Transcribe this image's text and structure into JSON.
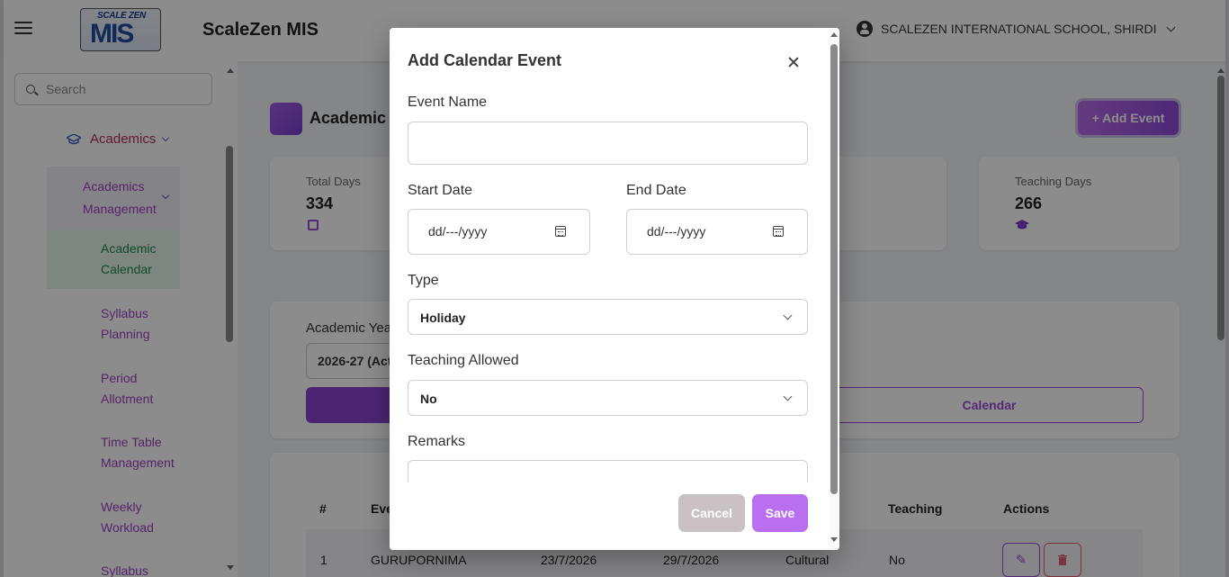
{
  "header": {
    "logo_top": "SCALE ZEN",
    "logo_main": "MIS",
    "app_title": "ScaleZen MIS",
    "school_name": "SCALEZEN INTERNATIONAL SCHOOL, SHIRDI"
  },
  "sidebar": {
    "search_placeholder": "Search",
    "section": "Academics",
    "group": [
      "Academics",
      "Management"
    ],
    "items": [
      {
        "line1": "Academic",
        "line2": "Calendar",
        "active": true
      },
      {
        "line1": "Syllabus",
        "line2": "Planning"
      },
      {
        "line1": "Period",
        "line2": "Allotment"
      },
      {
        "line1": "Time Table",
        "line2": "Management"
      },
      {
        "line1": "Weekly",
        "line2": "Workload"
      },
      {
        "line1": "Syllabus",
        "line2": ""
      }
    ]
  },
  "main": {
    "page_title": "Academic C",
    "add_event_label": "+ Add Event",
    "stats": {
      "total_days_label": "Total Days",
      "total_days_value": "334",
      "teaching_days_label": "Teaching Days",
      "teaching_days_value": "266"
    },
    "academic_year_label": "Academic Yea",
    "academic_year_value": "2026-27 (Act",
    "calendar_button": "Calendar",
    "table": {
      "headers": [
        "#",
        "Eve",
        "Teaching",
        "Actions"
      ],
      "rows": [
        {
          "num": "1",
          "event": "GURUPORNIMA",
          "start": "23/7/2026",
          "end": "29/7/2026",
          "type": "Cultural",
          "teaching": "No"
        }
      ]
    }
  },
  "modal": {
    "title": "Add Calendar Event",
    "event_name_label": "Event Name",
    "event_name_value": "",
    "start_date_label": "Start Date",
    "start_date_placeholder": "dd/---/yyyy",
    "end_date_label": "End Date",
    "end_date_placeholder": "dd/---/yyyy",
    "type_label": "Type",
    "type_value": "Holiday",
    "teaching_allowed_label": "Teaching Allowed",
    "teaching_allowed_value": "No",
    "remarks_label": "Remarks",
    "cancel_label": "Cancel",
    "save_label": "Save"
  }
}
